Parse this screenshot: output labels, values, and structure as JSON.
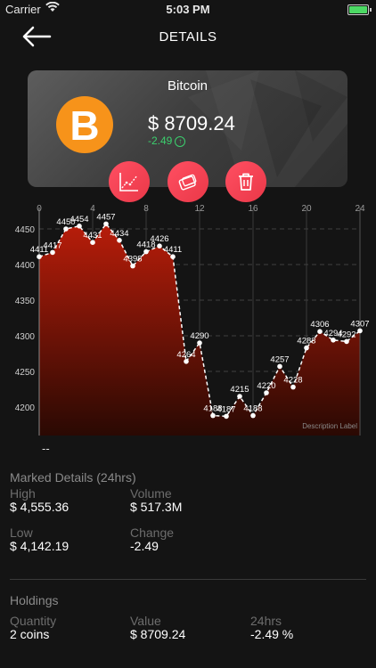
{
  "status_bar": {
    "carrier": "Carrier",
    "time": "5:03 PM"
  },
  "header": {
    "title": "DETAILS"
  },
  "coin": {
    "name": "Bitcoin",
    "symbol": "B",
    "price": "$ 8709.24",
    "change": "-2.49",
    "change_icon": "arrow-up-circle-icon"
  },
  "actions": [
    {
      "name": "chart-line-icon"
    },
    {
      "name": "wallet-icon"
    },
    {
      "name": "trash-icon"
    }
  ],
  "colors": {
    "accent": "#f7931a",
    "button_gradient_start": "#ff4f62",
    "positive": "#3ccf6e",
    "chart_fill_top": "#b81d0a",
    "chart_fill_bottom": "#2a0903"
  },
  "chart_data": {
    "type": "area",
    "x": [
      0,
      1,
      2,
      3,
      4,
      5,
      6,
      7,
      8,
      9,
      10,
      11,
      12,
      13,
      14,
      15,
      16,
      17,
      18,
      19,
      20,
      21,
      22,
      23,
      24
    ],
    "values": [
      4411,
      4417,
      4450,
      4454,
      4431,
      4457,
      4434,
      4398,
      4418,
      4426,
      4411,
      4264,
      4290,
      4188,
      4187,
      4215,
      4188,
      4220,
      4257,
      4228,
      4283,
      4306,
      4294,
      4292,
      4307
    ],
    "x_ticks": [
      0,
      4,
      8,
      12,
      16,
      20,
      24
    ],
    "y_ticks": [
      4200,
      4250,
      4300,
      4350,
      4400,
      4450
    ],
    "xlim": [
      0,
      24
    ],
    "ylim": [
      4160,
      4480
    ],
    "description_label": "Description Label",
    "grid": true
  },
  "selection_text": "--",
  "market": {
    "title": "Marked Details (24hrs)",
    "high_label": "High",
    "high": "$ 4,555.36",
    "volume_label": "Volume",
    "volume": "$ 517.3M",
    "low_label": "Low",
    "low": "$ 4,142.19",
    "change_label": "Change",
    "change": "-2.49"
  },
  "holdings": {
    "title": "Holdings",
    "quantity_label": "Quantity",
    "quantity": "2 coins",
    "value_label": "Value",
    "value": "$ 8709.24",
    "h24_label": "24hrs",
    "h24": "-2.49 %"
  }
}
